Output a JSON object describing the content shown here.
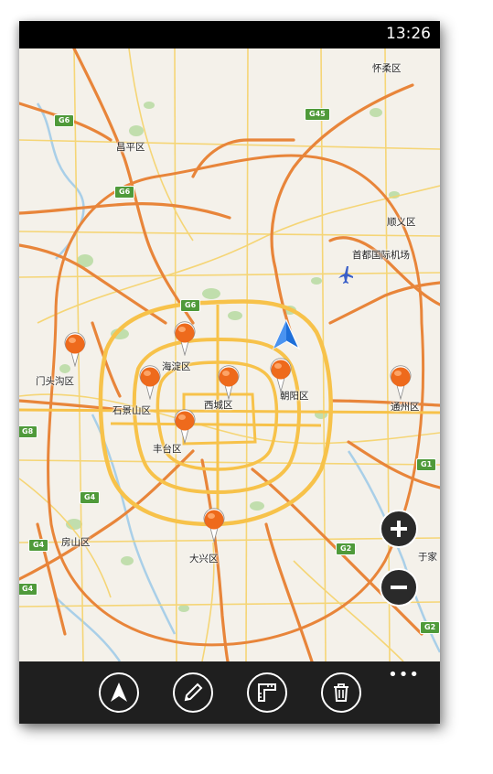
{
  "status_bar": {
    "time": "13:26"
  },
  "map": {
    "places": {
      "huairou": "怀柔区",
      "changping": "昌平区",
      "shunyi": "顺义区",
      "airport": "首都国际机场",
      "mentougou": "门头沟区",
      "haidian": "海淀区",
      "shijingshan": "石景山区",
      "xicheng": "西城区",
      "chaoyang": "朝阳区",
      "tongzhou": "通州区",
      "fengtai": "丰台区",
      "fangshan": "房山区",
      "daxing": "大兴区",
      "edge": "于家"
    },
    "route_shields": {
      "g6_top_left": "G6",
      "g45": "G45",
      "g6_mid": "G6",
      "g6_ring": "G6",
      "g4": "G4",
      "g4_lower": "G4",
      "g1": "G1",
      "g2": "G2",
      "g2_lower": "G2",
      "g8_edge": "G8",
      "g4_edge": "G4"
    },
    "pin_icon": "orange-map-pin-icon",
    "location_icon": "navigation-arrow-icon"
  },
  "zoom": {
    "in_icon": "plus-icon",
    "out_icon": "minus-icon"
  },
  "app_bar": {
    "buttons": [
      "navigate-icon",
      "pen-icon",
      "ruler-icon",
      "trash-icon"
    ],
    "more": "•••"
  },
  "colors": {
    "map_bg": "#f4f1ea",
    "highway": "#f5a623",
    "expressway": "#e8853a",
    "ring": "#f7c24a",
    "park": "#b7dba2",
    "water": "#a9cfe8",
    "pin": "#ee6a1c",
    "nav_arrow": "#1e6fd9",
    "app_bar": "#1f1f1f"
  }
}
